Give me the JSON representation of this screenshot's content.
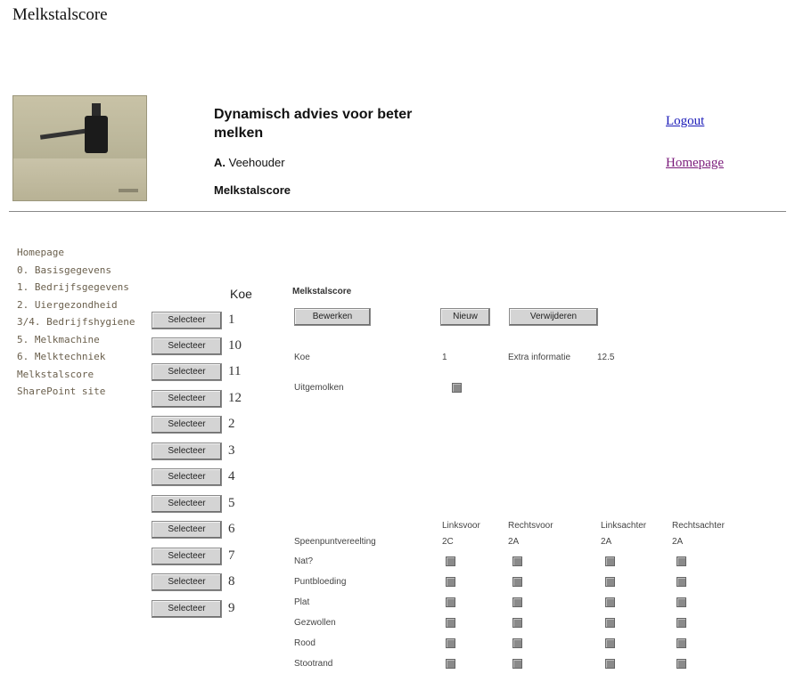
{
  "page_title": "Melkstalscore",
  "header": {
    "app_title": "Dynamisch advies voor beter melken",
    "user_initial": "A.",
    "user_name": "Veehouder",
    "section": "Melkstalscore",
    "logout": "Logout",
    "homepage": "Homepage"
  },
  "nav": {
    "items": [
      "Homepage",
      "0. Basisgegevens",
      "1. Bedrijfsgegevens",
      "2. Uiergezondheid",
      "3/4. Bedrijfshygiene",
      "5. Melkmachine",
      "6. Melktechniek",
      "Melkstalscore",
      "SharePoint site"
    ]
  },
  "koe_list": {
    "header": "Koe",
    "select_label": "Selecteer",
    "numbers": [
      "1",
      "10",
      "11",
      "12",
      "2",
      "3",
      "4",
      "5",
      "6",
      "7",
      "8",
      "9"
    ]
  },
  "form": {
    "title": "Melkstalscore",
    "edit_button": "Bewerken",
    "new_button": "Nieuw",
    "delete_button": "Verwijderen",
    "koe_label": "Koe",
    "koe_value": "1",
    "extra_label": "Extra informatie",
    "extra_value": "12.5",
    "uitgemolken_label": "Uitgemolken",
    "columns": [
      "Linksvoor",
      "Rechtsvoor",
      "Linksachter",
      "Rechtsachter"
    ],
    "speenpunt_label": "Speenpuntvereelting",
    "speenpunt_values": [
      "2C",
      "2A",
      "2A",
      "2A"
    ],
    "rows": [
      "Nat?",
      "Puntbloeding",
      "Plat",
      "Gezwollen",
      "Rood",
      "Stootrand"
    ]
  }
}
